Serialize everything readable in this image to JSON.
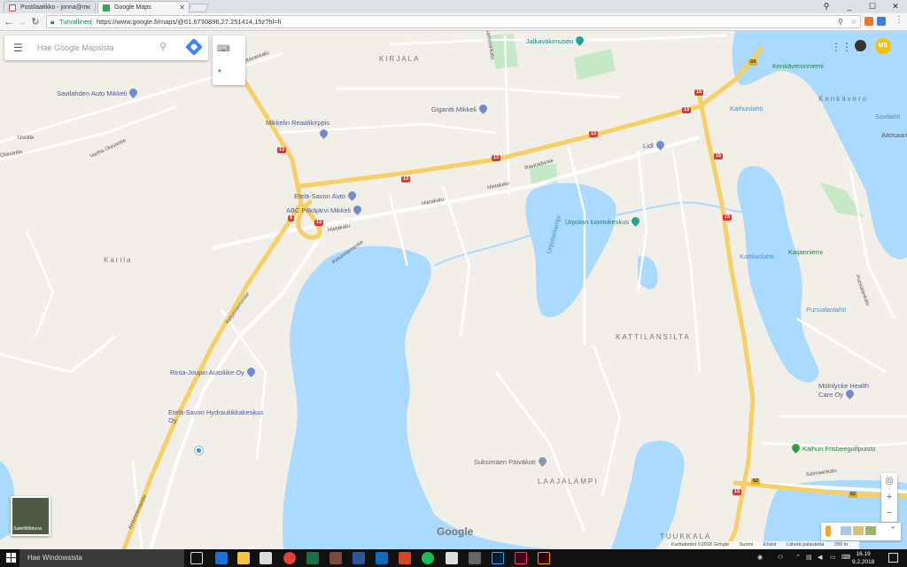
{
  "browser": {
    "tabs": [
      {
        "label": "Postilaatikko - jonna@m",
        "icon": "gmail-icon"
      },
      {
        "label": "Google Maps",
        "icon": "maps-icon"
      }
    ],
    "window_buttons": [
      "_",
      "☐",
      "✕"
    ],
    "secure_label": "Turvallinen",
    "url": "https://www.google.fi/maps/@61.6730896,27.251414,15z?hl=fi"
  },
  "search": {
    "placeholder": "Hae Google Mapsista"
  },
  "profile_initials": "MS",
  "map_labels": {
    "areas": [
      "KIRJALA",
      "Karila",
      "KATTILANSILTA",
      "LAAJALAMPI",
      "TUUKKALA",
      "Kenkävero"
    ],
    "pois": [
      {
        "name": "Jalkaväkimuseo",
        "kind": "teal"
      },
      {
        "name": "Kenkäveronniemi",
        "kind": "green"
      },
      {
        "name": "Savilahden Auto Mikkeli",
        "kind": "blue"
      },
      {
        "name": "Gigantti Mikkeli",
        "kind": "blue"
      },
      {
        "name": "Mikkelin Reaalikirppis",
        "kind": "blue"
      },
      {
        "name": "Kaihunlahti",
        "kind": "water"
      },
      {
        "name": "Lidl",
        "kind": "blue"
      },
      {
        "name": "Etelä-Savon Auto",
        "kind": "blue"
      },
      {
        "name": "ABC Pitkäjärvi Mikkeli",
        "kind": "blue"
      },
      {
        "name": "Urpolan luontokeskus",
        "kind": "teal"
      },
      {
        "name": "Kattilanlahti",
        "kind": "water"
      },
      {
        "name": "Kaijanniemi",
        "kind": "green"
      },
      {
        "name": "Pursialanlahti",
        "kind": "water"
      },
      {
        "name": "Savilahti",
        "kind": "water"
      },
      {
        "name": "Aitosaari",
        "kind": "plain"
      },
      {
        "name": "Urpolanlampi",
        "kind": "water"
      },
      {
        "name": "Rinta-Joupin Autoliike Oy",
        "kind": "blue"
      },
      {
        "name": "Etelä-Savon Hydrauliikkakeskus Oy",
        "kind": "blue"
      },
      {
        "name": "Mölnlycke Health Care Oy",
        "kind": "blue"
      },
      {
        "name": "Kaihun Frisbeegolfpuisto",
        "kind": "green"
      },
      {
        "name": "Suksimäen Päiväkoti",
        "kind": "gray"
      }
    ],
    "streets": [
      "Otavankatu",
      "Vanha Otavantie",
      "Otavantie",
      "Hietakatu",
      "Ketunniementie",
      "Saimaankatu",
      "Pursialankatu",
      "Sammonkatu",
      "Uusitie",
      "Raviradantie"
    ],
    "road_numbers": [
      "13",
      "15",
      "24",
      "62",
      "5"
    ]
  },
  "controls": {
    "satellite_label": "Satelliittikuva",
    "google_logo": "Google",
    "zoom_in": "+",
    "zoom_out": "−"
  },
  "attribution": {
    "data": "Karttatiedot ©2018 Google",
    "country": "Suomi",
    "terms": "Ehdot",
    "feedback": "Lähetä palautetta",
    "scale": "200 m"
  },
  "taskbar": {
    "search_placeholder": "Hae Windowsista",
    "time": "16.19",
    "date": "9.2.2018"
  },
  "colors": {
    "water": "#aadaff",
    "park": "#c5e8c5",
    "highway": "#f9d56e",
    "land": "#f2efe9",
    "accent": "#4285f4"
  }
}
